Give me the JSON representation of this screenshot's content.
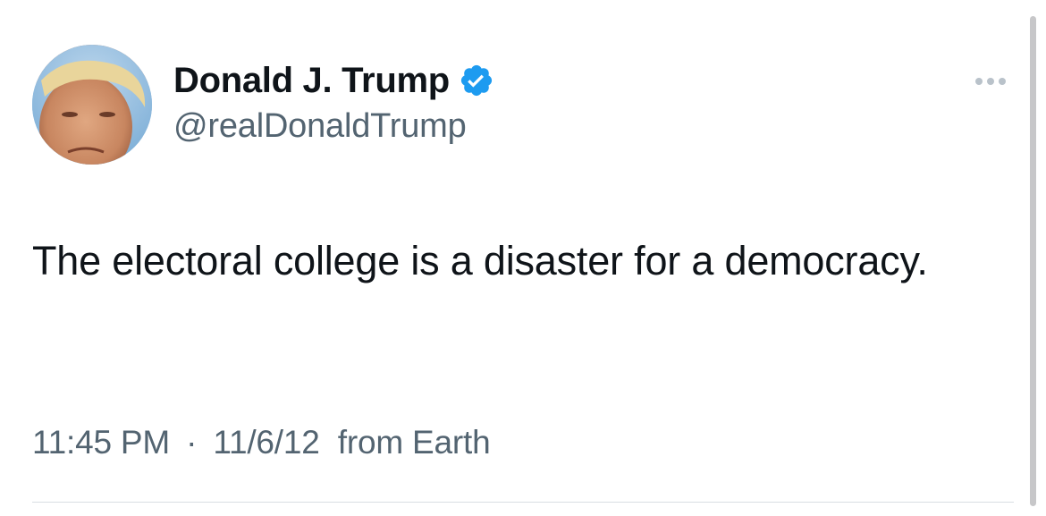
{
  "author": {
    "display_name": "Donald J. Trump",
    "handle": "@realDonaldTrump",
    "verified": true,
    "verified_badge_color": "#1d9bf0",
    "avatar_icon": "profile-photo"
  },
  "tweet": {
    "text": "The electoral college is a disaster for a democracy."
  },
  "meta": {
    "time": "11:45 PM",
    "separator": "·",
    "date": "11/6/12",
    "source": "from Earth"
  },
  "colors": {
    "text_primary": "#0f1419",
    "text_secondary": "#536471",
    "divider": "#d8dee3"
  }
}
